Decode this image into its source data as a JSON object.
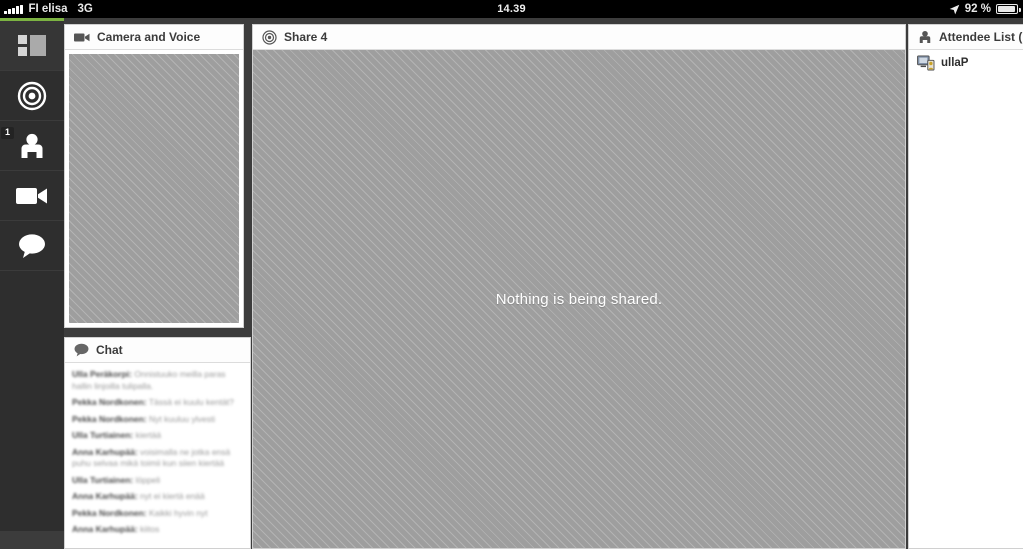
{
  "statusbar": {
    "carrier": "FI elisa",
    "network": "3G",
    "time": "14.39",
    "battery_percent": "92 %",
    "signal_icon": "signal-bars-icon",
    "location_icon": "location-arrow-icon",
    "battery_icon": "battery-icon"
  },
  "sidebar": {
    "accent_color": "#7cb342",
    "items": [
      {
        "name": "layout",
        "icon": "layout-grid-icon",
        "label": "Layout",
        "active": true,
        "badge": ""
      },
      {
        "name": "share",
        "icon": "target-share-icon",
        "label": "Share",
        "active": false,
        "badge": ""
      },
      {
        "name": "attendees",
        "icon": "person-icon",
        "label": "Attendees",
        "active": false,
        "badge": "1"
      },
      {
        "name": "camera",
        "icon": "video-camera-icon",
        "label": "Camera",
        "active": false,
        "badge": ""
      },
      {
        "name": "chat",
        "icon": "chat-bubble-icon",
        "label": "Chat",
        "active": false,
        "badge": ""
      }
    ]
  },
  "camera_panel": {
    "title": "Camera and Voice",
    "icon": "video-camera-icon"
  },
  "share_panel": {
    "title": "Share 4",
    "icon": "target-share-icon",
    "empty_message": "Nothing is being shared."
  },
  "attendee_panel": {
    "title": "Attendee List (",
    "icon": "person-icon",
    "attendees": [
      {
        "name": "ullaP",
        "icon": "computer-user-icon"
      }
    ]
  },
  "chat_panel": {
    "title": "Chat",
    "icon": "chat-bubble-icon",
    "messages": [
      {
        "sender": "Ulla Peräkorpi",
        "text": "Onnistuuko meilla paras hallin linjoilla tulipalla."
      },
      {
        "sender": "Pekka Nordkonen",
        "text": "Tässä ei kuulu kentät?"
      },
      {
        "sender": "Pekka Nordkonen",
        "text": "Nyt kuuluu ylvesti"
      },
      {
        "sender": "Ulla Turtiainen",
        "text": "kiertää"
      },
      {
        "sender": "Anna Karhupää",
        "text": "voisimalla ne jotka ensä puhu selvaa mikä toimii kun siien kiertää"
      },
      {
        "sender": "Ulla Turtiainen",
        "text": "löppeli"
      },
      {
        "sender": "Anna Karhupää",
        "text": "nyt ei kiertä enää"
      },
      {
        "sender": "Pekka Nordkonen",
        "text": "Kaikki hyvin nyt"
      },
      {
        "sender": "Anna Karhupää",
        "text": "kiitos"
      }
    ]
  }
}
